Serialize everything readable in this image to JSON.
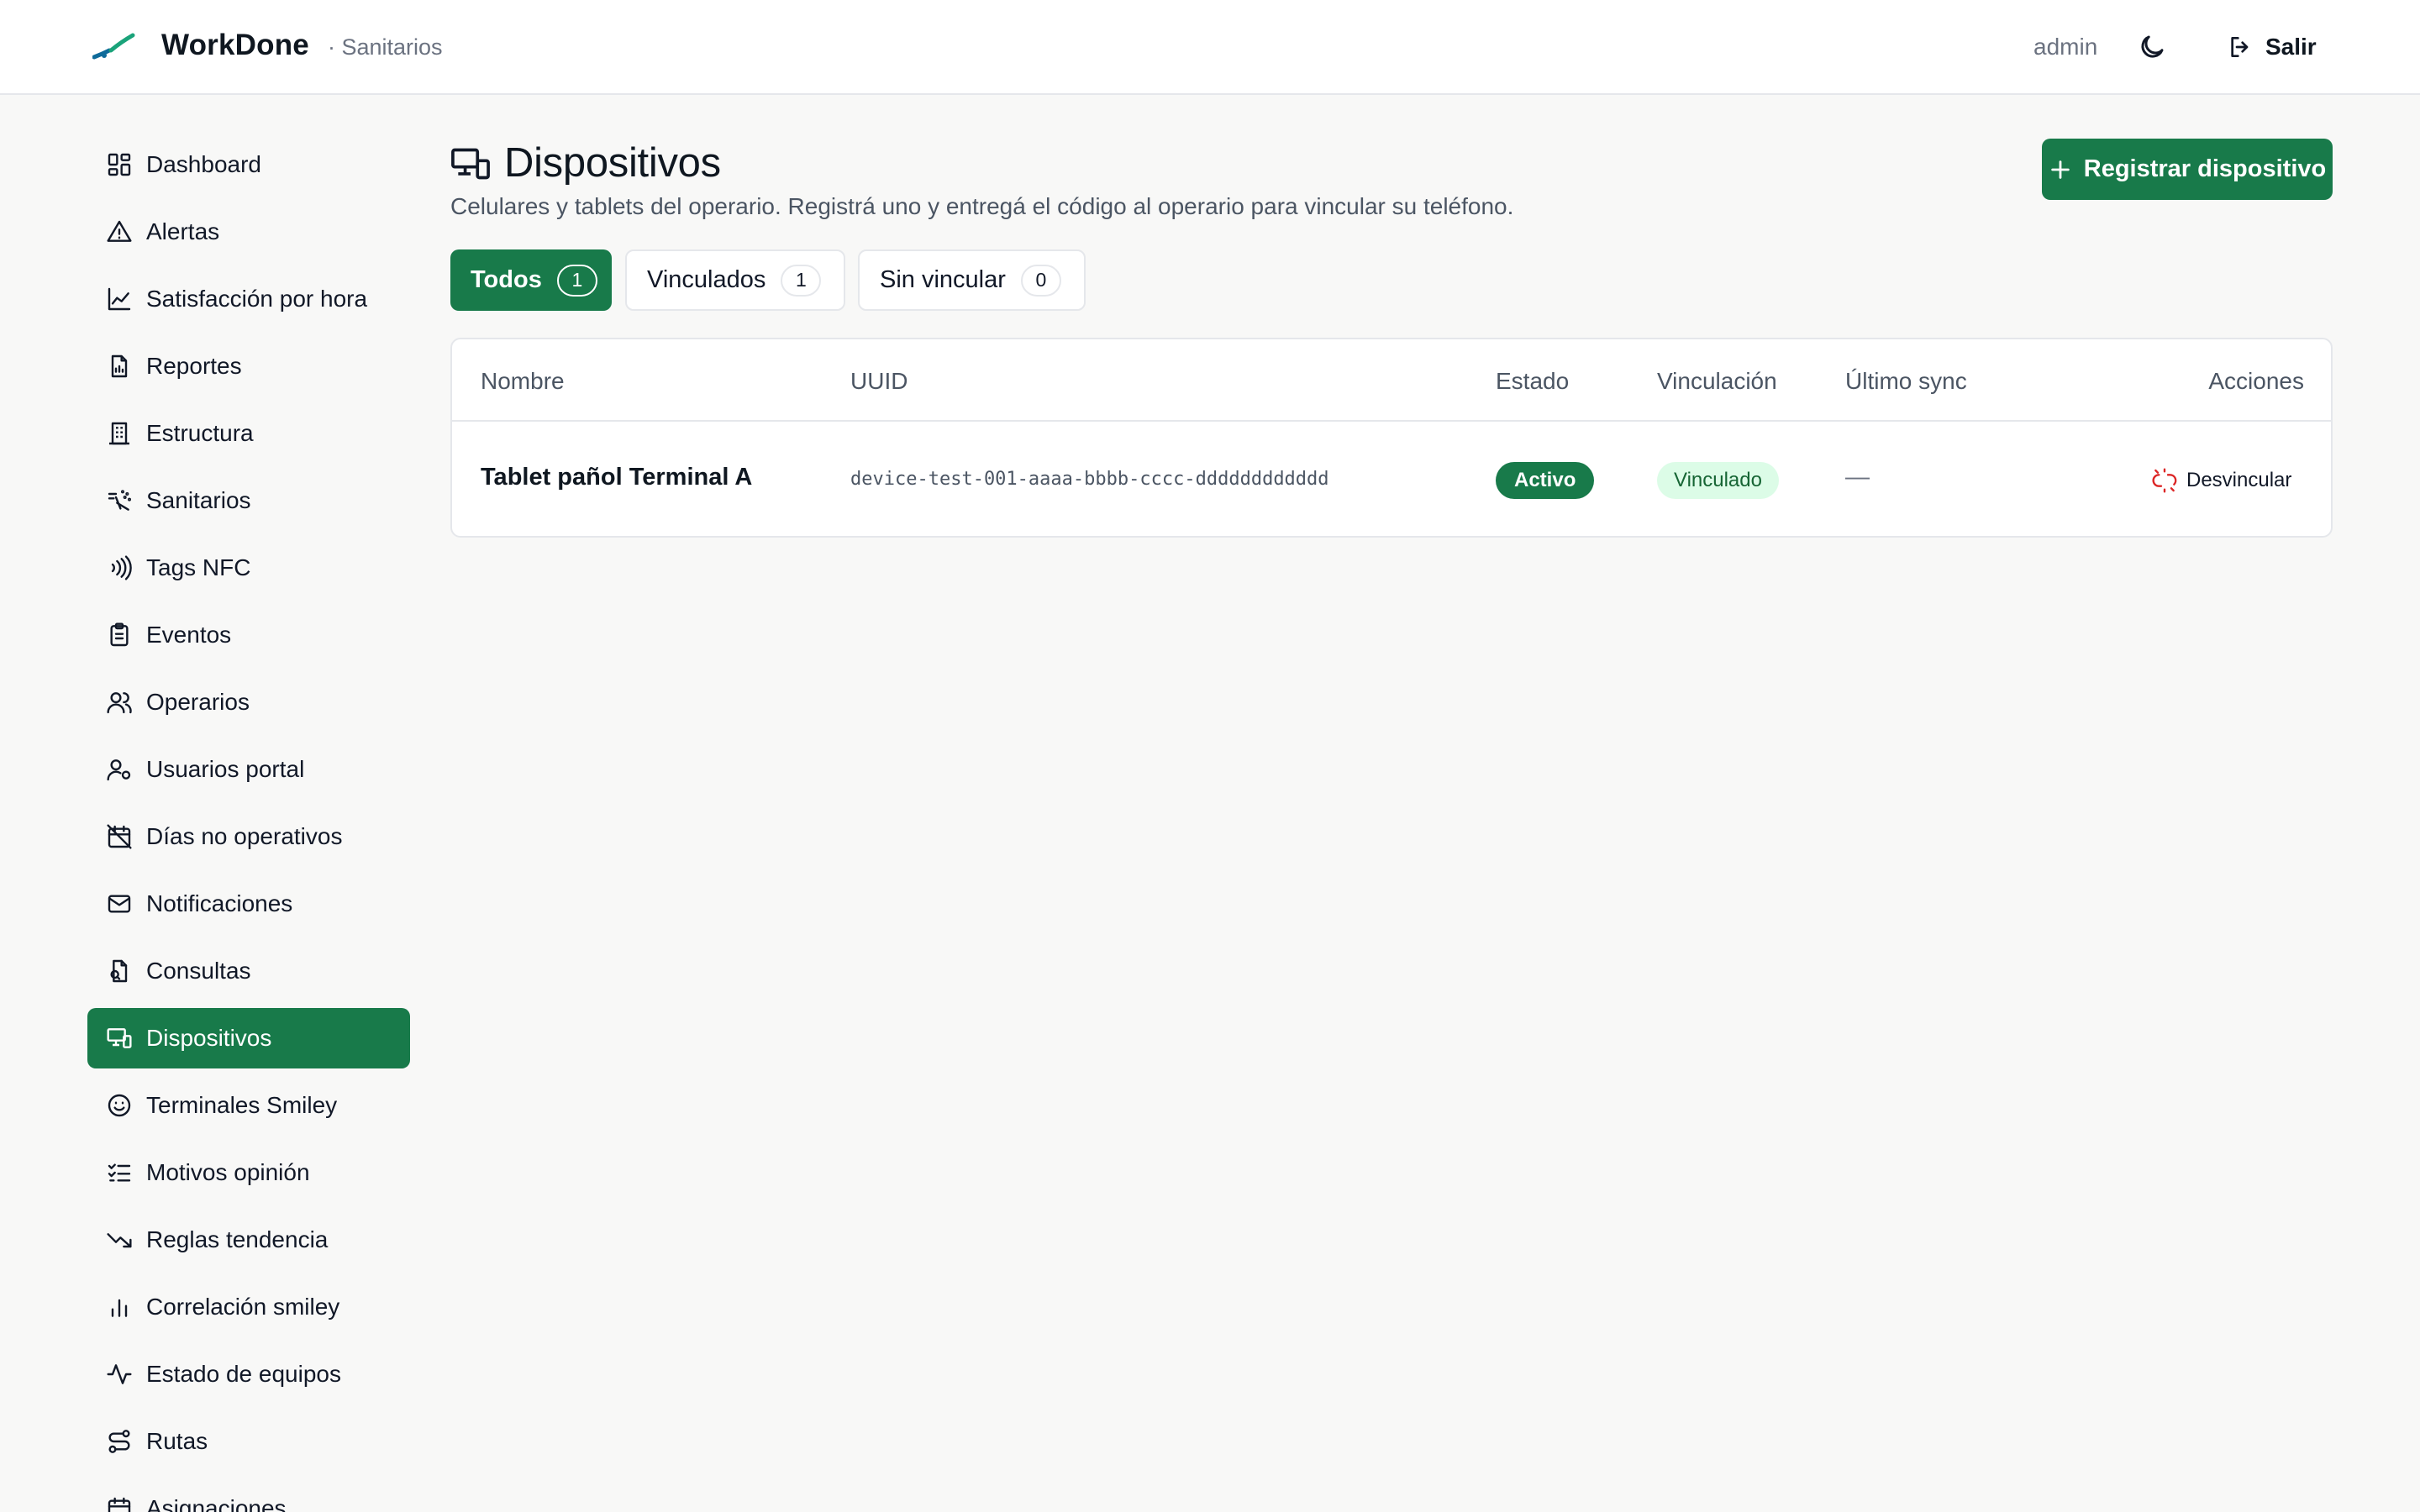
{
  "header": {
    "app_name": "WorkDone",
    "section": "· Sanitarios",
    "user": "admin",
    "logout_label": "Salir"
  },
  "sidebar": {
    "items": [
      {
        "label": "Dashboard",
        "icon": "dashboard-icon"
      },
      {
        "label": "Alertas",
        "icon": "alert-triangle-icon"
      },
      {
        "label": "Satisfacción por hora",
        "icon": "line-chart-icon"
      },
      {
        "label": "Reportes",
        "icon": "report-file-icon"
      },
      {
        "label": "Estructura",
        "icon": "building-icon"
      },
      {
        "label": "Sanitarios",
        "icon": "spray-icon"
      },
      {
        "label": "Tags NFC",
        "icon": "nfc-icon"
      },
      {
        "label": "Eventos",
        "icon": "clipboard-list-icon"
      },
      {
        "label": "Operarios",
        "icon": "users-icon"
      },
      {
        "label": "Usuarios portal",
        "icon": "user-cog-icon"
      },
      {
        "label": "Días no operativos",
        "icon": "calendar-off-icon"
      },
      {
        "label": "Notificaciones",
        "icon": "mail-icon"
      },
      {
        "label": "Consultas",
        "icon": "file-search-icon"
      },
      {
        "label": "Dispositivos",
        "icon": "devices-icon",
        "active": true
      },
      {
        "label": "Terminales Smiley",
        "icon": "smiley-icon"
      },
      {
        "label": "Motivos opinión",
        "icon": "list-checks-icon"
      },
      {
        "label": "Reglas tendencia",
        "icon": "trending-down-icon"
      },
      {
        "label": "Correlación smiley",
        "icon": "bar-chart-icon"
      },
      {
        "label": "Estado de equipos",
        "icon": "activity-icon"
      },
      {
        "label": "Rutas",
        "icon": "route-icon"
      },
      {
        "label": "Asignaciones",
        "icon": "calendar-icon"
      }
    ]
  },
  "page": {
    "title": "Dispositivos",
    "description": "Celulares y tablets del operario. Registrá uno y entregá el código al operario para vincular su teléfono.",
    "primary_button": "Registrar dispositivo"
  },
  "tabs": [
    {
      "label": "Todos",
      "count": "1",
      "active": true
    },
    {
      "label": "Vinculados",
      "count": "1",
      "active": false
    },
    {
      "label": "Sin vincular",
      "count": "0",
      "active": false
    }
  ],
  "table": {
    "columns": [
      "Nombre",
      "UUID",
      "Estado",
      "Vinculación",
      "Último sync",
      "Acciones"
    ],
    "rows": [
      {
        "name": "Tablet pañol Terminal A",
        "uuid": "device-test-001-aaaa-bbbb-cccc-dddddddddddd",
        "status": "Activo",
        "link": "Vinculado",
        "last_sync": "—",
        "action": "Desvincular"
      }
    ]
  },
  "colors": {
    "accent": "#187a4a",
    "linked_badge_bg": "#dcfce7",
    "danger": "#dc2626"
  }
}
